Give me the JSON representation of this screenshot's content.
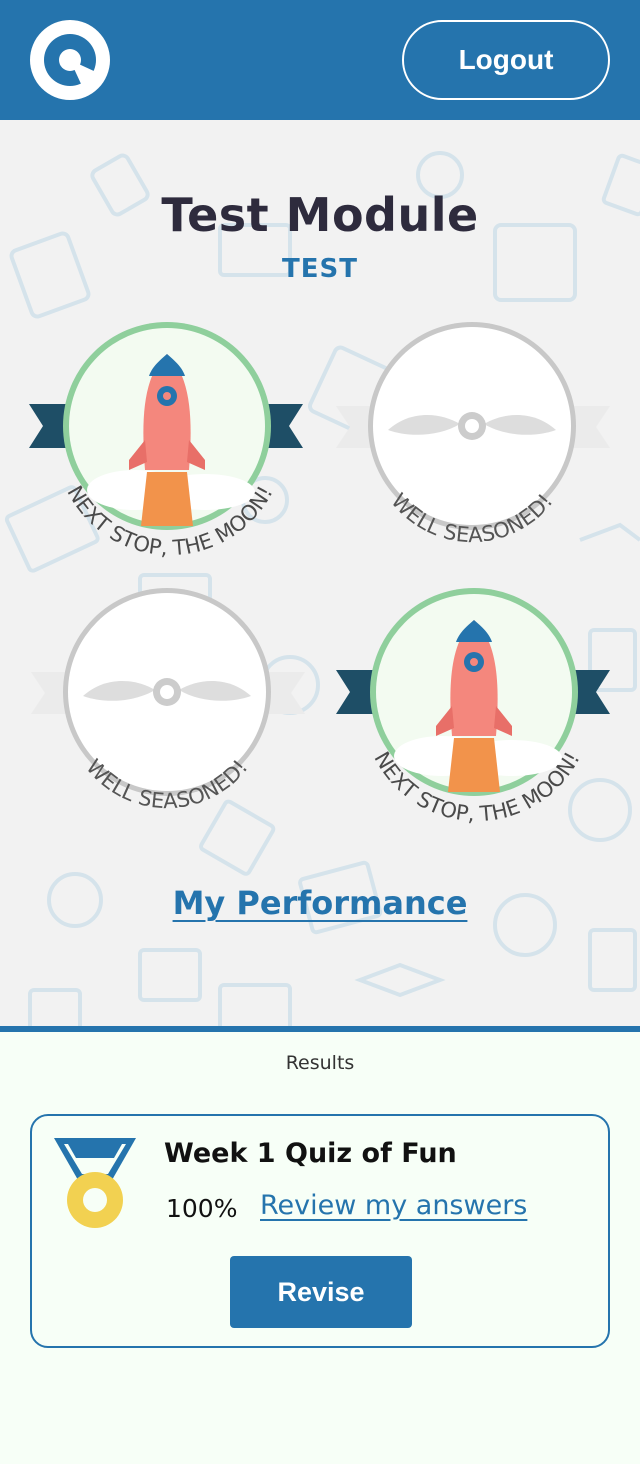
{
  "header": {
    "logout_label": "Logout",
    "logo_icon": "app-logo-icon"
  },
  "module": {
    "title": "Test Module",
    "subtitle": "TEST"
  },
  "badges": [
    {
      "caption": "NEXT STOP, THE MOON!",
      "state": "earned",
      "icon": "rocket-icon"
    },
    {
      "caption": "WELL SEASONED!",
      "state": "locked",
      "icon": "wings-icon"
    },
    {
      "caption": "WELL SEASONED!",
      "state": "locked",
      "icon": "wings-icon"
    },
    {
      "caption": "NEXT STOP, THE MOON!",
      "state": "earned",
      "icon": "rocket-icon"
    }
  ],
  "performance_link": "My Performance",
  "results": {
    "label": "Results",
    "items": [
      {
        "name": "Week 1 Quiz of Fun",
        "score": "100%",
        "review_label": "Review my answers",
        "revise_label": "Revise",
        "icon": "medal-icon"
      }
    ]
  },
  "colors": {
    "primary": "#2574ad",
    "title": "#2e2b3d",
    "earned_ring": "#8fcf9c",
    "locked_ring": "#c8c8c8",
    "ribbon": "#1e4e66",
    "medal_gold": "#f2d151"
  }
}
